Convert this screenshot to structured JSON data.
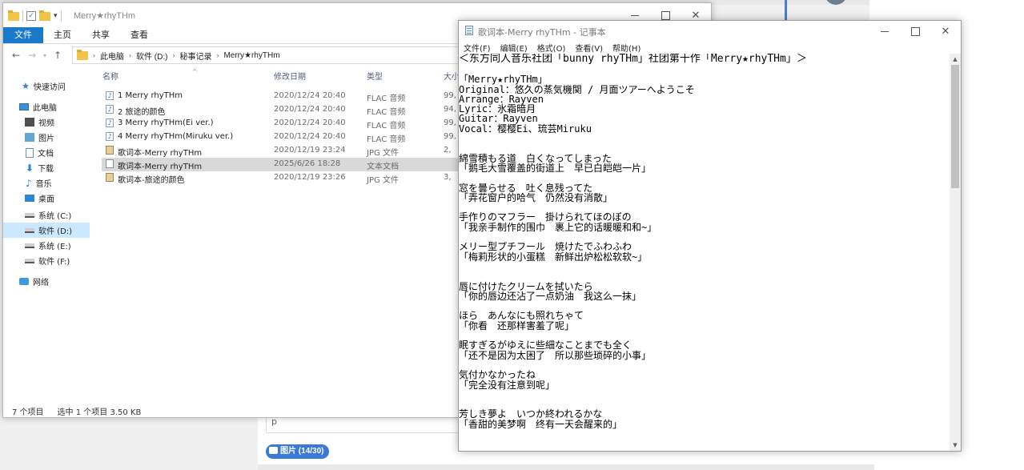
{
  "background": {
    "comment_placeholder": "p",
    "image_badge": "图片 (14/30)"
  },
  "explorer": {
    "title": "Merry★rhyTHm",
    "ribbon_tabs": [
      "文件",
      "主页",
      "共享",
      "查看"
    ],
    "breadcrumb": [
      "此电脑",
      "软件 (D:)",
      "秘事记录",
      "Merry★rhyTHm"
    ],
    "nav_items": [
      {
        "label": "快速访问",
        "icon": "star-icon"
      },
      {
        "label": "此电脑",
        "icon": "pc-icon"
      },
      {
        "label": "视频",
        "icon": "video-icon"
      },
      {
        "label": "图片",
        "icon": "pictures-icon"
      },
      {
        "label": "文档",
        "icon": "documents-icon"
      },
      {
        "label": "下载",
        "icon": "download-icon"
      },
      {
        "label": "音乐",
        "icon": "music-icon"
      },
      {
        "label": "桌面",
        "icon": "desktop-icon"
      },
      {
        "label": "系统 (C:)",
        "icon": "drive-icon"
      },
      {
        "label": "软件 (D:)",
        "icon": "drive-icon",
        "selected": true
      },
      {
        "label": "系统 (E:)",
        "icon": "drive-icon"
      },
      {
        "label": "软件 (F:)",
        "icon": "drive-icon"
      },
      {
        "label": "网络",
        "icon": "network-icon"
      }
    ],
    "columns": {
      "name": "名称",
      "date": "修改日期",
      "type": "类型",
      "size": "大小"
    },
    "files": [
      {
        "name": "1 Merry rhyTHm",
        "date": "2020/12/24 20:40",
        "type": "FLAC 音频",
        "size": "99,",
        "icon": "audio-file-icon"
      },
      {
        "name": "2 旅途的颜色",
        "date": "2020/12/24 20:40",
        "type": "FLAC 音频",
        "size": "94,",
        "icon": "audio-file-icon"
      },
      {
        "name": "3 Merry rhyTHm(Ei ver.)",
        "date": "2020/12/24 20:40",
        "type": "FLAC 音频",
        "size": "99,",
        "icon": "audio-file-icon"
      },
      {
        "name": "4 Merry rhyTHm(Miruku ver.)",
        "date": "2020/12/24 20:40",
        "type": "FLAC 音频",
        "size": "99,",
        "icon": "audio-file-icon"
      },
      {
        "name": "歌词本-Merry rhyTHm",
        "date": "2020/12/19 23:24",
        "type": "JPG 文件",
        "size": "2,",
        "icon": "image-file-icon"
      },
      {
        "name": "歌词本-Merry rhyTHm",
        "date": "2025/6/26 18:28",
        "type": "文本文档",
        "size": "",
        "icon": "text-file-icon",
        "selected": true
      },
      {
        "name": "歌词本-旅途的颜色",
        "date": "2020/12/19 23:26",
        "type": "JPG 文件",
        "size": "3,",
        "icon": "image-file-icon"
      }
    ],
    "status": {
      "count": "7 个项目",
      "selection": "选中 1 个项目 3.50 KB"
    }
  },
  "notepad": {
    "title": "歌词本-Merry rhyTHm - 记事本",
    "menu": [
      "文件(F)",
      "编辑(E)",
      "格式(O)",
      "查看(V)",
      "帮助(H)"
    ],
    "lines": [
      "＜东方同人音乐社团「bunny rhyTHm」社团第十作「Merry★rhyTHm」＞",
      "",
      "「Merry★rhyTHm」",
      "Original：悠久の蒸気機関 / 月面ツアーへようこそ",
      "Arrange：Rayven",
      "Lyric：氷霜暗月",
      "Guitar：Rayven",
      "Vocal：樱樱Ei、琉芸Miruku",
      "",
      "",
      "綿雪積もる道　白くなってしまった",
      "「鹅毛大雪覆盖的街道上　早已白皑皑一片」",
      "",
      "窓を曇らせる　吐く息残ってた",
      "「弄花窗户的哈气　仍然没有消散」",
      "",
      "手作りのマフラー　掛けられてほのぼの",
      "「我亲手制作的围巾　裹上它的话暖暖和和~」",
      "",
      "メリー型プチフール　焼けたでふわふわ",
      "「梅莉形状的小蛋糕　新鲜出炉松松软软~」",
      "",
      "",
      "唇に付けたクリームを拭いたら",
      "「你的唇边还沾了一点奶油　我这么一抹」",
      "",
      "ほら　あんなにも照れちゃて",
      "「你看　还那样害羞了呢」",
      "",
      "眠すぎるがゆえに些細なことまでも全く",
      "「还不是因为太困了　所以那些琐碎的小事」",
      "",
      "気付かなかったね",
      "「完全没有注意到呢」",
      "",
      "",
      "芳しき夢よ　いつか終われるかな",
      "「香甜的美梦啊　终有一天会醒来的」"
    ]
  }
}
